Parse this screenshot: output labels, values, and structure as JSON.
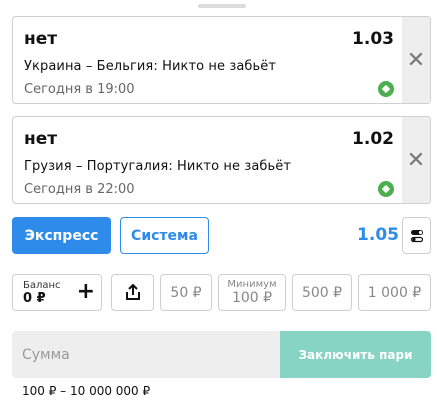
{
  "coupon": {
    "bets": [
      {
        "outcome": "нет",
        "odds": "1.03",
        "event": "Украина – Бельгия: Никто не забьёт",
        "time": "Сегодня в 19:00",
        "sport_icon": "soccer-ball-icon"
      },
      {
        "outcome": "нет",
        "odds": "1.02",
        "event": "Грузия – Португалия: Никто не забьёт",
        "time": "Сегодня в 22:00",
        "sport_icon": "soccer-ball-icon"
      }
    ]
  },
  "bet_type": {
    "express_label": "Экспресс",
    "system_label": "Система",
    "total_odds": "1.05",
    "selected": "express"
  },
  "stake": {
    "balance_label": "Баланс",
    "balance_value": "0 ₽",
    "quick_amounts": {
      "a50": "50 ₽",
      "a500": "500 ₽",
      "a1000": "1 000 ₽"
    },
    "min_label": "Минимум",
    "min_value": "100 ₽",
    "sum_placeholder": "Сумма",
    "place_label": "Заключить пари",
    "range_hint": "100 ₽ – 10 000 000 ₽"
  },
  "colors": {
    "accent": "#2f8bea",
    "place_button": "#87d3c4",
    "sport_icon": "#4cae4f"
  }
}
